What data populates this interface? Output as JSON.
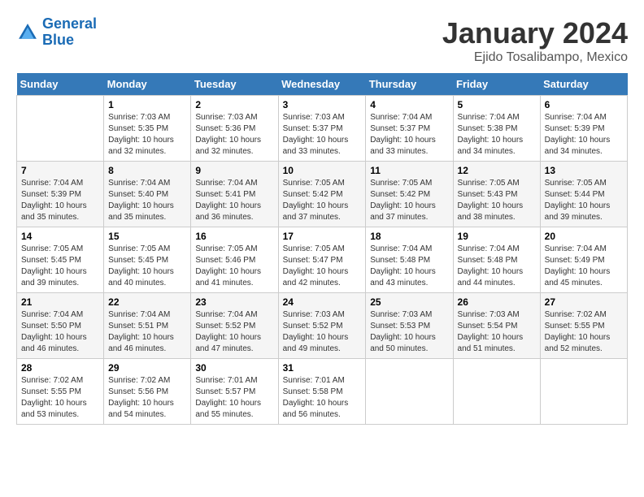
{
  "header": {
    "logo_line1": "General",
    "logo_line2": "Blue",
    "title": "January 2024",
    "location": "Ejido Tosalibampo, Mexico"
  },
  "days_of_week": [
    "Sunday",
    "Monday",
    "Tuesday",
    "Wednesday",
    "Thursday",
    "Friday",
    "Saturday"
  ],
  "weeks": [
    [
      {
        "day": "",
        "sunrise": "",
        "sunset": "",
        "daylight": ""
      },
      {
        "day": "1",
        "sunrise": "Sunrise: 7:03 AM",
        "sunset": "Sunset: 5:35 PM",
        "daylight": "Daylight: 10 hours and 32 minutes."
      },
      {
        "day": "2",
        "sunrise": "Sunrise: 7:03 AM",
        "sunset": "Sunset: 5:36 PM",
        "daylight": "Daylight: 10 hours and 32 minutes."
      },
      {
        "day": "3",
        "sunrise": "Sunrise: 7:03 AM",
        "sunset": "Sunset: 5:37 PM",
        "daylight": "Daylight: 10 hours and 33 minutes."
      },
      {
        "day": "4",
        "sunrise": "Sunrise: 7:04 AM",
        "sunset": "Sunset: 5:37 PM",
        "daylight": "Daylight: 10 hours and 33 minutes."
      },
      {
        "day": "5",
        "sunrise": "Sunrise: 7:04 AM",
        "sunset": "Sunset: 5:38 PM",
        "daylight": "Daylight: 10 hours and 34 minutes."
      },
      {
        "day": "6",
        "sunrise": "Sunrise: 7:04 AM",
        "sunset": "Sunset: 5:39 PM",
        "daylight": "Daylight: 10 hours and 34 minutes."
      }
    ],
    [
      {
        "day": "7",
        "sunrise": "Sunrise: 7:04 AM",
        "sunset": "Sunset: 5:39 PM",
        "daylight": "Daylight: 10 hours and 35 minutes."
      },
      {
        "day": "8",
        "sunrise": "Sunrise: 7:04 AM",
        "sunset": "Sunset: 5:40 PM",
        "daylight": "Daylight: 10 hours and 35 minutes."
      },
      {
        "day": "9",
        "sunrise": "Sunrise: 7:04 AM",
        "sunset": "Sunset: 5:41 PM",
        "daylight": "Daylight: 10 hours and 36 minutes."
      },
      {
        "day": "10",
        "sunrise": "Sunrise: 7:05 AM",
        "sunset": "Sunset: 5:42 PM",
        "daylight": "Daylight: 10 hours and 37 minutes."
      },
      {
        "day": "11",
        "sunrise": "Sunrise: 7:05 AM",
        "sunset": "Sunset: 5:42 PM",
        "daylight": "Daylight: 10 hours and 37 minutes."
      },
      {
        "day": "12",
        "sunrise": "Sunrise: 7:05 AM",
        "sunset": "Sunset: 5:43 PM",
        "daylight": "Daylight: 10 hours and 38 minutes."
      },
      {
        "day": "13",
        "sunrise": "Sunrise: 7:05 AM",
        "sunset": "Sunset: 5:44 PM",
        "daylight": "Daylight: 10 hours and 39 minutes."
      }
    ],
    [
      {
        "day": "14",
        "sunrise": "Sunrise: 7:05 AM",
        "sunset": "Sunset: 5:45 PM",
        "daylight": "Daylight: 10 hours and 39 minutes."
      },
      {
        "day": "15",
        "sunrise": "Sunrise: 7:05 AM",
        "sunset": "Sunset: 5:45 PM",
        "daylight": "Daylight: 10 hours and 40 minutes."
      },
      {
        "day": "16",
        "sunrise": "Sunrise: 7:05 AM",
        "sunset": "Sunset: 5:46 PM",
        "daylight": "Daylight: 10 hours and 41 minutes."
      },
      {
        "day": "17",
        "sunrise": "Sunrise: 7:05 AM",
        "sunset": "Sunset: 5:47 PM",
        "daylight": "Daylight: 10 hours and 42 minutes."
      },
      {
        "day": "18",
        "sunrise": "Sunrise: 7:04 AM",
        "sunset": "Sunset: 5:48 PM",
        "daylight": "Daylight: 10 hours and 43 minutes."
      },
      {
        "day": "19",
        "sunrise": "Sunrise: 7:04 AM",
        "sunset": "Sunset: 5:48 PM",
        "daylight": "Daylight: 10 hours and 44 minutes."
      },
      {
        "day": "20",
        "sunrise": "Sunrise: 7:04 AM",
        "sunset": "Sunset: 5:49 PM",
        "daylight": "Daylight: 10 hours and 45 minutes."
      }
    ],
    [
      {
        "day": "21",
        "sunrise": "Sunrise: 7:04 AM",
        "sunset": "Sunset: 5:50 PM",
        "daylight": "Daylight: 10 hours and 46 minutes."
      },
      {
        "day": "22",
        "sunrise": "Sunrise: 7:04 AM",
        "sunset": "Sunset: 5:51 PM",
        "daylight": "Daylight: 10 hours and 46 minutes."
      },
      {
        "day": "23",
        "sunrise": "Sunrise: 7:04 AM",
        "sunset": "Sunset: 5:52 PM",
        "daylight": "Daylight: 10 hours and 47 minutes."
      },
      {
        "day": "24",
        "sunrise": "Sunrise: 7:03 AM",
        "sunset": "Sunset: 5:52 PM",
        "daylight": "Daylight: 10 hours and 49 minutes."
      },
      {
        "day": "25",
        "sunrise": "Sunrise: 7:03 AM",
        "sunset": "Sunset: 5:53 PM",
        "daylight": "Daylight: 10 hours and 50 minutes."
      },
      {
        "day": "26",
        "sunrise": "Sunrise: 7:03 AM",
        "sunset": "Sunset: 5:54 PM",
        "daylight": "Daylight: 10 hours and 51 minutes."
      },
      {
        "day": "27",
        "sunrise": "Sunrise: 7:02 AM",
        "sunset": "Sunset: 5:55 PM",
        "daylight": "Daylight: 10 hours and 52 minutes."
      }
    ],
    [
      {
        "day": "28",
        "sunrise": "Sunrise: 7:02 AM",
        "sunset": "Sunset: 5:55 PM",
        "daylight": "Daylight: 10 hours and 53 minutes."
      },
      {
        "day": "29",
        "sunrise": "Sunrise: 7:02 AM",
        "sunset": "Sunset: 5:56 PM",
        "daylight": "Daylight: 10 hours and 54 minutes."
      },
      {
        "day": "30",
        "sunrise": "Sunrise: 7:01 AM",
        "sunset": "Sunset: 5:57 PM",
        "daylight": "Daylight: 10 hours and 55 minutes."
      },
      {
        "day": "31",
        "sunrise": "Sunrise: 7:01 AM",
        "sunset": "Sunset: 5:58 PM",
        "daylight": "Daylight: 10 hours and 56 minutes."
      },
      {
        "day": "",
        "sunrise": "",
        "sunset": "",
        "daylight": ""
      },
      {
        "day": "",
        "sunrise": "",
        "sunset": "",
        "daylight": ""
      },
      {
        "day": "",
        "sunrise": "",
        "sunset": "",
        "daylight": ""
      }
    ]
  ]
}
